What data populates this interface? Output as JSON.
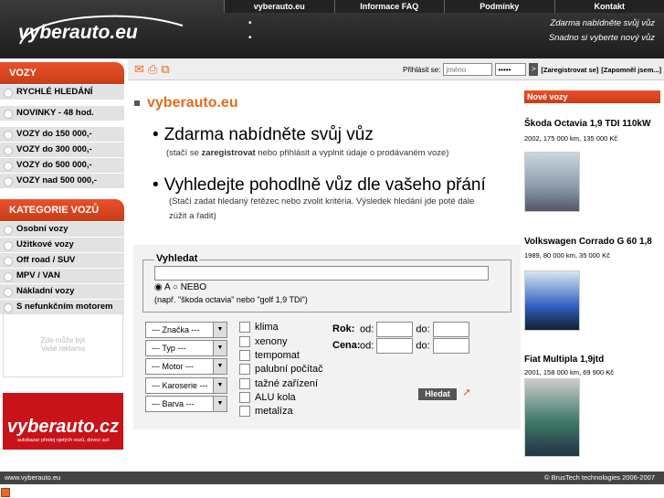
{
  "nav": [
    "vyberauto.eu",
    "Informace FAQ",
    "Podmínky",
    "Kontakt"
  ],
  "logo": "vyberauto.eu",
  "slogan": [
    "Zdarma nabídněte svůj vůz",
    "Snadno si vyberte nový vůz"
  ],
  "login": {
    "label": "Přihlásit se:",
    "user_placeholder": "jméno",
    "pass_value": "•••••",
    "go": ">",
    "register": "[Zaregistrovat se]",
    "forgot": "[Zapomněl jsem...]"
  },
  "icons": [
    "envelope-icon",
    "printer-icon",
    "sitemap-icon"
  ],
  "sidebar": {
    "vozy_title": "VOZY",
    "vozy_items": [
      "RYCHLÉ HLEDÁNÍ",
      "NOVINKY - 48 hod.",
      "VOZY do    150 000,-",
      "VOZY do    300 000,-",
      "VOZY do    500 000,-",
      "VOZY nad   500 000,-"
    ],
    "kategorie_title": "KATEGORIE VOZŮ",
    "kategorie_items": [
      "Osobní vozy",
      "Užitkové vozy",
      "Off road / SUV",
      "MPV / VAN",
      "Nákladní vozy",
      "S nefunkčním motorem"
    ],
    "ad_text": [
      "Zde může být",
      "Vaše reklama"
    ],
    "banner_title": "vyberauto.cz",
    "banner_sub": "autobazar předej ojetých vozů, dovoz aut"
  },
  "main": {
    "title": "vyberauto.eu",
    "h1": "Zdarma nabídněte svůj vůz",
    "h1_sub_pre": "(stačí se",
    "h1_sub_bold": "zaregistrovat",
    "h1_sub_post": "nebo přihlásit a vyplnit údaje o prodávaném voze)",
    "h2": "Vyhledejte pohodlně vůz dle vašeho přání",
    "h2_sub1": "(Stačí zadat hledaný řetězec nebo zvolit kritéria. Výsledek hledání jde poté dále",
    "h2_sub2": "zúžit a řadit)"
  },
  "search": {
    "legend": "Vyhledat",
    "radio_a": "A",
    "radio_nebo": "NEBO",
    "hint": "(např. \"škoda octavia\" nebo \"golf 1,9 TDi\")",
    "selects": [
      "--- Značka ---",
      "--- Typ ---",
      "--- Motor ---",
      "--- Karoserie ---",
      "--- Barva ---"
    ],
    "checks": [
      "klima",
      "xenony",
      "tempomat",
      "palubní počítač",
      "tažné zařízení",
      "ALU kola",
      "metalíza"
    ],
    "rok": "Rok:",
    "cena": "Cena:",
    "od": "od:",
    "do": "do:",
    "button": "Hledat"
  },
  "new_cars": {
    "title": "Nové vozy",
    "items": [
      {
        "name": "Škoda Octavia 1,9 TDI 110kW",
        "info": "2002, 175 000 km, 135 000 Kč",
        "color": "#8a9aa8"
      },
      {
        "name": "Volkswagen Corrado G 60 1,8",
        "info": "1989, 80 000 km, 35 000 Kč",
        "color": "#2f5fc0"
      },
      {
        "name": "Fiat Multipla 1,9jtd",
        "info": "2001, 158 000 km, 69 900 Kč",
        "color": "#3f7a6a"
      }
    ]
  },
  "footer": {
    "left": "www.vyberauto.eu",
    "right": "© BrusTech technologies 2006-2007"
  }
}
